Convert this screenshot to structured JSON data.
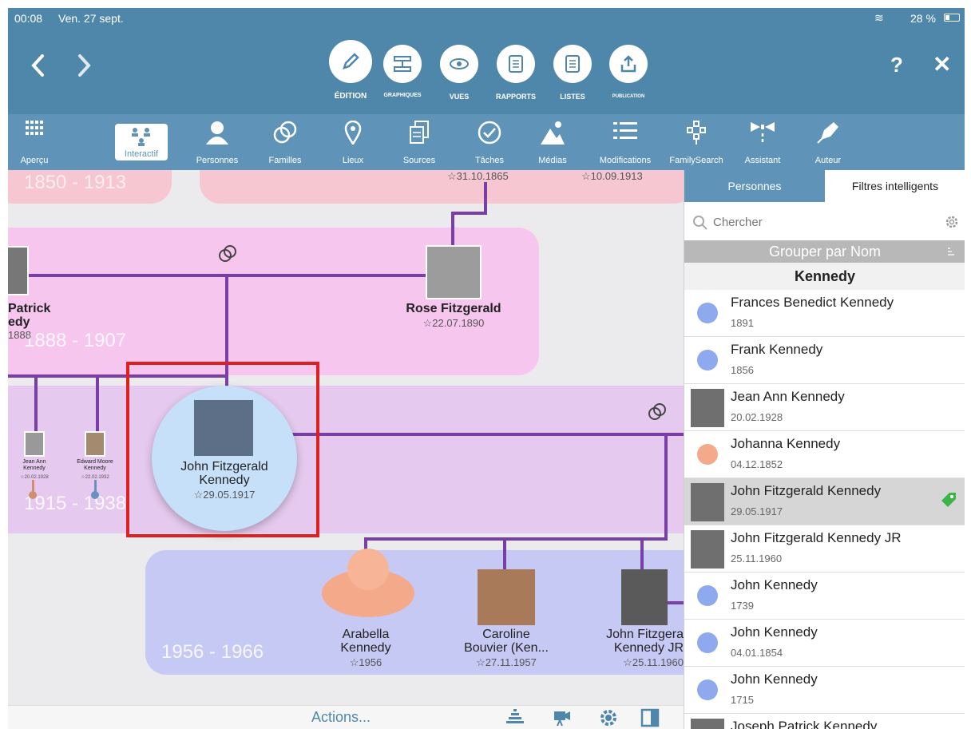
{
  "status": {
    "time": "00:08",
    "date": "Ven. 27 sept.",
    "battery": "28 %"
  },
  "nav": {
    "back_icon": "chevron-left-icon",
    "forward_icon": "chevron-right-icon",
    "help": "?",
    "close": "✕",
    "modes": [
      {
        "label": "ÉDITION",
        "icon": "pencil-icon"
      },
      {
        "label": "GRAPHIQUES",
        "icon": "chart-icon"
      },
      {
        "label": "VUES",
        "icon": "eye-icon"
      },
      {
        "label": "RAPPORTS",
        "icon": "report-icon"
      },
      {
        "label": "LISTES",
        "icon": "list-icon"
      },
      {
        "label": "PUBLICATION",
        "icon": "upload-icon"
      }
    ]
  },
  "tools": [
    {
      "label": "Aperçu",
      "icon": "grid-icon"
    },
    {
      "label": "Interactif",
      "icon": "tree-icon"
    },
    {
      "label": "Personnes",
      "icon": "person-icon"
    },
    {
      "label": "Familles",
      "icon": "rings-icon"
    },
    {
      "label": "Lieux",
      "icon": "pin-icon"
    },
    {
      "label": "Sources",
      "icon": "documents-icon"
    },
    {
      "label": "Tâches",
      "icon": "check-icon"
    },
    {
      "label": "Médias",
      "icon": "mountain-icon"
    },
    {
      "label": "Modifications",
      "icon": "list-lines-icon"
    },
    {
      "label": "FamilySearch",
      "icon": "familysearch-icon"
    },
    {
      "label": "Assistant",
      "icon": "wizard-icon"
    },
    {
      "label": "Auteur",
      "icon": "pen-icon"
    }
  ],
  "chart": {
    "bands": [
      {
        "years": "1850 - 1913"
      },
      {
        "years": "1888 - 1907"
      },
      {
        "years": "1915 - 1938"
      },
      {
        "years": "1956 - 1966"
      }
    ],
    "top_dates": [
      "☆31.10.1865",
      "☆10.09.1913"
    ],
    "people": {
      "patrick": {
        "name_line1": "Patrick",
        "name_line2": "edy",
        "date": "1888"
      },
      "rose": {
        "name": "Rose Fitzgerald",
        "date": "☆22.07.1890"
      },
      "jean_small": {
        "name": "Jean Ann Kennedy",
        "date": "☆20.02.1928"
      },
      "edward_small": {
        "name": "Edward Moore Kennedy",
        "date": "☆22.02.1932"
      },
      "jfk": {
        "name_line1": "John Fitzgerald",
        "name_line2": "Kennedy",
        "date": "☆29.05.1917"
      },
      "arabella": {
        "name_line1": "Arabella",
        "name_line2": "Kennedy",
        "date": "☆1956"
      },
      "caroline": {
        "name_line1": "Caroline",
        "name_line2": "Bouvier (Ken...",
        "date": "☆27.11.1957"
      },
      "jfkjr": {
        "name_line1": "John Fitzgera",
        "name_line2": "Kennedy JR",
        "date": "☆25.11.1960"
      }
    }
  },
  "panel": {
    "tabs": [
      "Personnes",
      "Filtres intelligents"
    ],
    "search_placeholder": "Chercher",
    "group_by": "Grouper par Nom",
    "section": "Kennedy",
    "rows": [
      {
        "name": "Frances Benedict Kennedy",
        "date": "1891",
        "kind": "dot",
        "color": "#8fa9ee"
      },
      {
        "name": "Frank Kennedy",
        "date": "1856",
        "kind": "dot",
        "color": "#8fa9ee"
      },
      {
        "name": "Jean Ann Kennedy",
        "date": "20.02.1928",
        "kind": "photo"
      },
      {
        "name": "Johanna Kennedy",
        "date": "04.12.1852",
        "kind": "dot",
        "color": "#f5a98b"
      },
      {
        "name": "John Fitzgerald Kennedy",
        "date": "29.05.1917",
        "kind": "photo",
        "selected": true
      },
      {
        "name": "John Fitzgerald Kennedy JR",
        "date": "25.11.1960",
        "kind": "photo"
      },
      {
        "name": "John Kennedy",
        "date": "1739",
        "kind": "dot",
        "color": "#8fa9ee"
      },
      {
        "name": "John Kennedy",
        "date": "04.01.1854",
        "kind": "dot",
        "color": "#8fa9ee"
      },
      {
        "name": "John Kennedy",
        "date": "1715",
        "kind": "dot",
        "color": "#8fa9ee"
      },
      {
        "name": "Joseph Patrick Kennedy",
        "date": "",
        "kind": "photo"
      }
    ]
  },
  "bottom": {
    "actions": "Actions..."
  },
  "colors": {
    "toolbar": "#4f87aa",
    "subbar": "#5f94b8",
    "line": "#7a3fa6",
    "highlight": "#e02020"
  }
}
